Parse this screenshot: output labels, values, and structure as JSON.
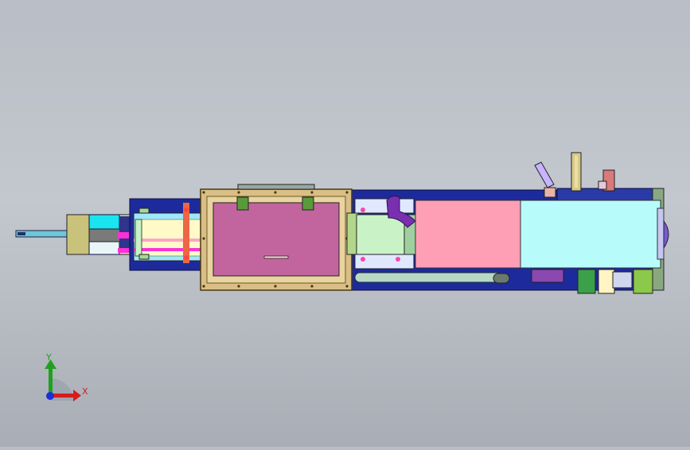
{
  "viewport": {
    "background": "#bcc1c8",
    "model": "machine-assembly-top-view"
  },
  "triad": {
    "x_label": "X",
    "y_label": "Y",
    "x_color": "#d81c1c",
    "y_color": "#20a020",
    "origin_color": "#1a2fd8"
  },
  "colors": {
    "frame_blue": "#1d2a9c",
    "door_frame": "#d9be86",
    "door_panel": "#c2659e",
    "pink_panel": "#ff9fb6",
    "cyan_panel": "#b8fbfb",
    "yellow_panel": "#fffac8",
    "green_panel": "#c9f3c6",
    "magenta_part": "#ff2fd8",
    "purple_pipe": "#7a2fb0"
  }
}
